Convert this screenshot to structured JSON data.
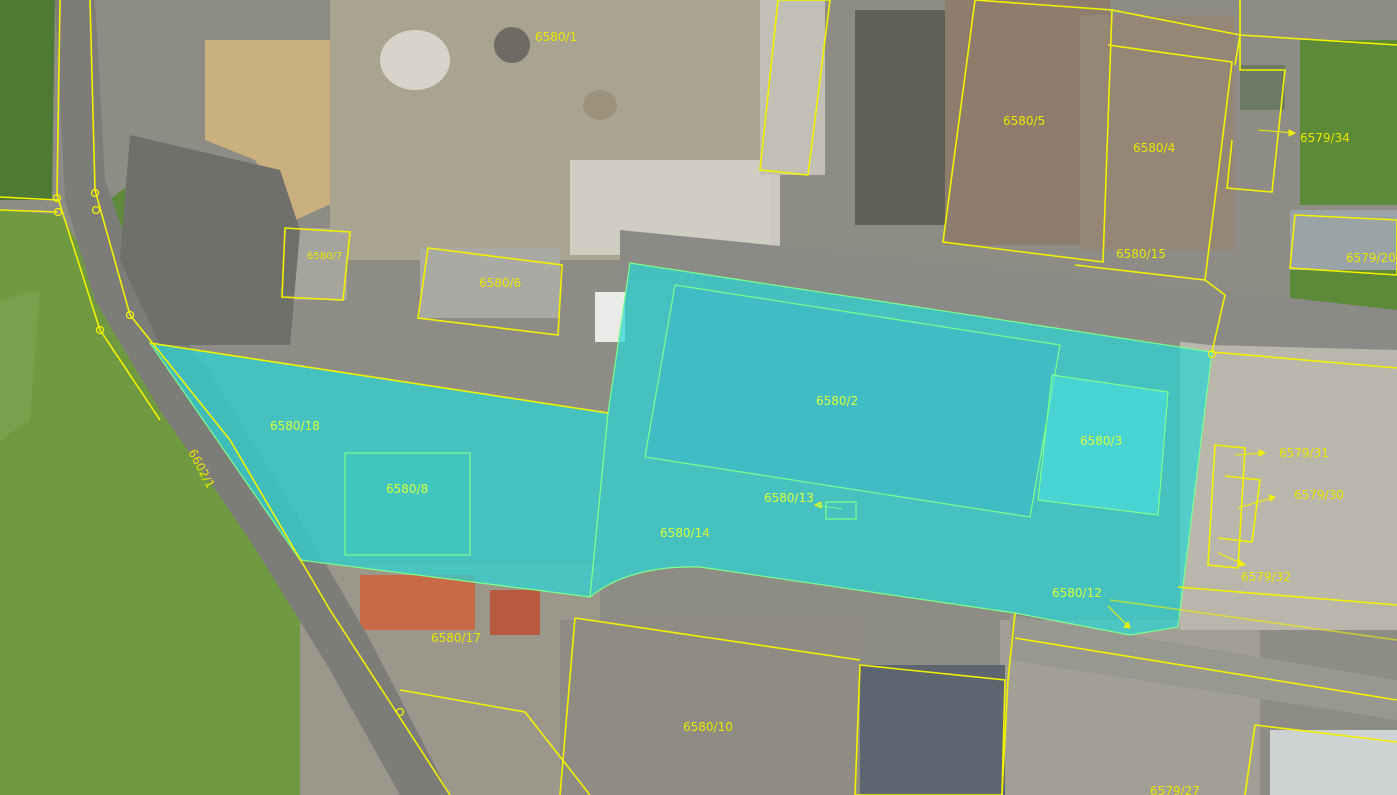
{
  "map": {
    "type": "cadastral-orthophoto",
    "colors": {
      "boundary": "#f2f200",
      "selected_fill": "#2ad6d6",
      "selected_stroke": "#7dff8a",
      "grass": "#6e9a44",
      "asphalt": "#8d8d86",
      "roof_rust": "#8f7b6a",
      "roof_grey": "#9c9d98"
    },
    "parcels": [
      {
        "id": "p-6580-1",
        "label": "6580/1",
        "selected": false
      },
      {
        "id": "p-6580-5",
        "label": "6580/5",
        "selected": false
      },
      {
        "id": "p-6580-4",
        "label": "6580/4",
        "selected": false
      },
      {
        "id": "p-6580-15",
        "label": "6580/15",
        "selected": false
      },
      {
        "id": "p-6579-34",
        "label": "6579/34",
        "selected": false
      },
      {
        "id": "p-6579-20",
        "label": "6579/20",
        "selected": false
      },
      {
        "id": "p-6580-7",
        "label": "6580/7",
        "selected": false
      },
      {
        "id": "p-6580-6",
        "label": "6580/6",
        "selected": false
      },
      {
        "id": "p-6580-18",
        "label": "6580/18",
        "selected": true
      },
      {
        "id": "p-6580-2",
        "label": "6580/2",
        "selected": true
      },
      {
        "id": "p-6580-3",
        "label": "6580/3",
        "selected": true
      },
      {
        "id": "p-6580-8",
        "label": "6580/8",
        "selected": true
      },
      {
        "id": "p-6580-13",
        "label": "6580/13",
        "selected": true
      },
      {
        "id": "p-6580-14",
        "label": "6580/14",
        "selected": true
      },
      {
        "id": "p-6580-12",
        "label": "6580/12",
        "selected": true
      },
      {
        "id": "p-6579-31",
        "label": "6579/31",
        "selected": false
      },
      {
        "id": "p-6579-30",
        "label": "6579/30",
        "selected": false
      },
      {
        "id": "p-6579-32",
        "label": "6579/32",
        "selected": false
      },
      {
        "id": "p-6580-17",
        "label": "6580/17",
        "selected": false
      },
      {
        "id": "p-6580-10",
        "label": "6580/10",
        "selected": false
      },
      {
        "id": "p-6579-27",
        "label": "6579/27",
        "selected": false
      },
      {
        "id": "p-6602-1",
        "label": "6602/1",
        "selected": false
      }
    ]
  }
}
